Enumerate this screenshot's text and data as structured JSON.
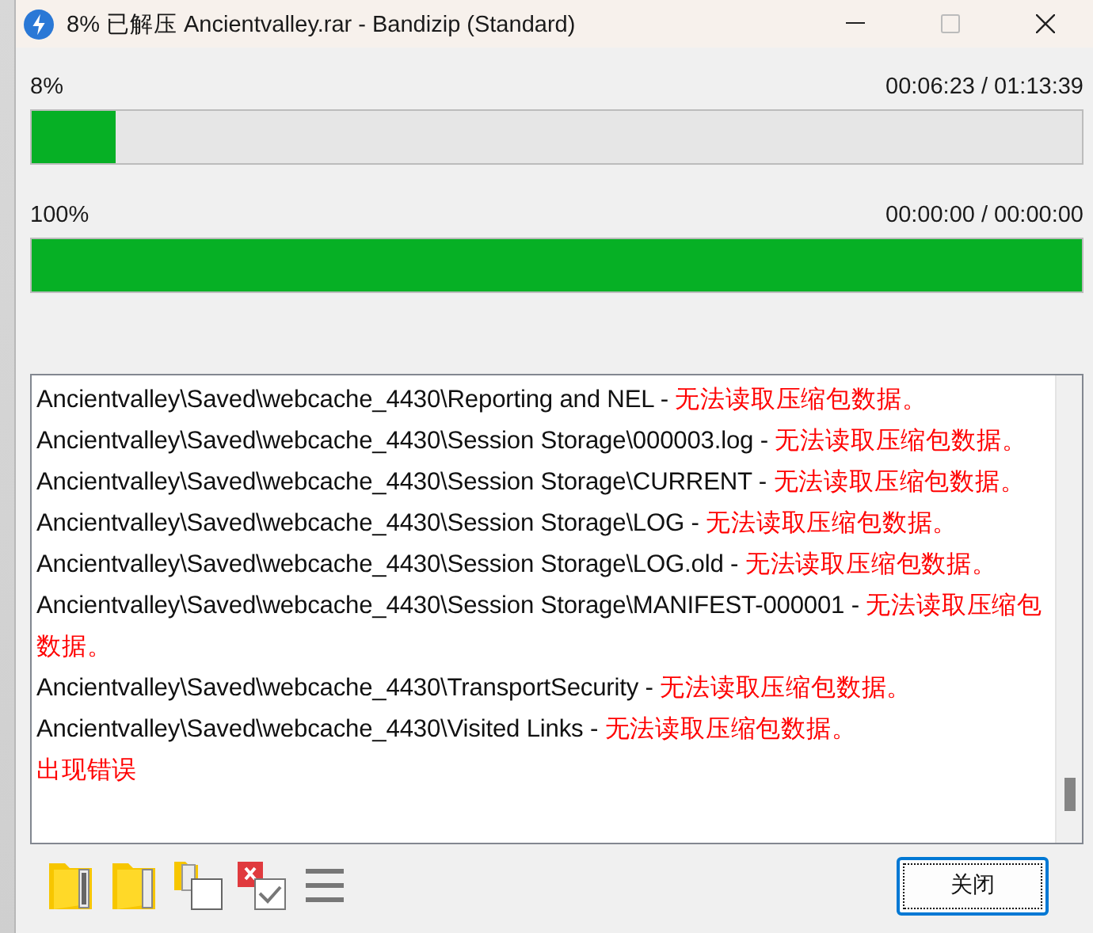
{
  "window": {
    "title": "8% 已解压 Ancientvalley.rar - Bandizip (Standard)"
  },
  "progress": [
    {
      "percent": "8%",
      "time": "00:06:23 / 01:13:39",
      "level": 0.08
    },
    {
      "percent": "100%",
      "time": "00:00:00 / 00:00:00",
      "level": 1
    }
  ],
  "log": [
    {
      "kind": "file",
      "path": "Ancientvalley\\Saved\\webcache_4430\\Reporting and NEL -",
      "error": "无法读取压缩包数据。"
    },
    {
      "kind": "file",
      "path": "Ancientvalley\\Saved\\webcache_4430\\Session Storage\\000003.log -",
      "error": "无法读取压缩包数据。"
    },
    {
      "kind": "file",
      "path": "Ancientvalley\\Saved\\webcache_4430\\Session Storage\\CURRENT -",
      "error": "无法读取压缩包数据。"
    },
    {
      "kind": "file",
      "path": "Ancientvalley\\Saved\\webcache_4430\\Session Storage\\LOG -",
      "error": "无法读取压缩包数据。"
    },
    {
      "kind": "file",
      "path": "Ancientvalley\\Saved\\webcache_4430\\Session Storage\\LOG.old -",
      "error": "无法读取压缩包数据。"
    },
    {
      "kind": "file",
      "path": "Ancientvalley\\Saved\\webcache_4430\\Session Storage\\MANIFEST-000001 -",
      "error": "无法读取压缩包数据。"
    },
    {
      "kind": "file",
      "path": "Ancientvalley\\Saved\\webcache_4430\\TransportSecurity -",
      "error": "无法读取压缩包数据。"
    },
    {
      "kind": "file",
      "path": "Ancientvalley\\Saved\\webcache_4430\\Visited Links -",
      "error": "无法读取压缩包数据。"
    },
    {
      "kind": "summary",
      "error": "出现错误"
    }
  ],
  "close_button": "关闭"
}
